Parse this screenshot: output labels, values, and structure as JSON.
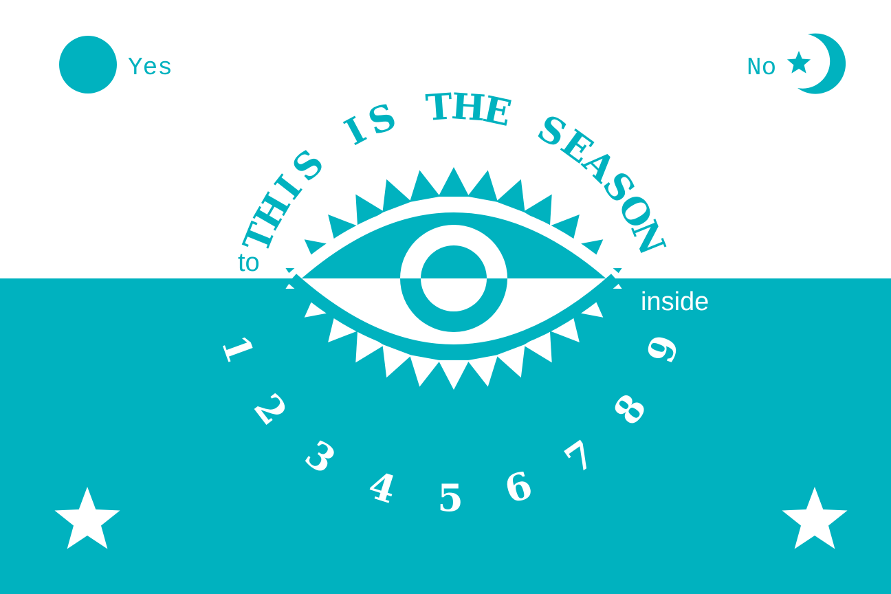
{
  "colors": {
    "teal": "#00b2bf",
    "white": "#ffffff"
  },
  "corners": {
    "yes": {
      "label": "Yes",
      "icon": "sun-circle-icon"
    },
    "no": {
      "label": "No",
      "icon": "star-moon-icon"
    },
    "bottom_left_icon": "star-icon",
    "bottom_right_icon": "star-icon"
  },
  "headline": {
    "words": [
      {
        "letters": [
          "T",
          "H",
          "I",
          "S"
        ]
      },
      {
        "letters": [
          "I",
          "S"
        ]
      },
      {
        "letters": [
          "T",
          "H",
          "E"
        ]
      },
      {
        "letters": [
          "S",
          "E",
          "A",
          "S",
          "O",
          "N"
        ]
      }
    ]
  },
  "captions": {
    "before": "to",
    "after": "inside"
  },
  "center_icon": "eye-icon",
  "numbers": [
    "1",
    "2",
    "3",
    "4",
    "5",
    "6",
    "7",
    "8",
    "9"
  ]
}
